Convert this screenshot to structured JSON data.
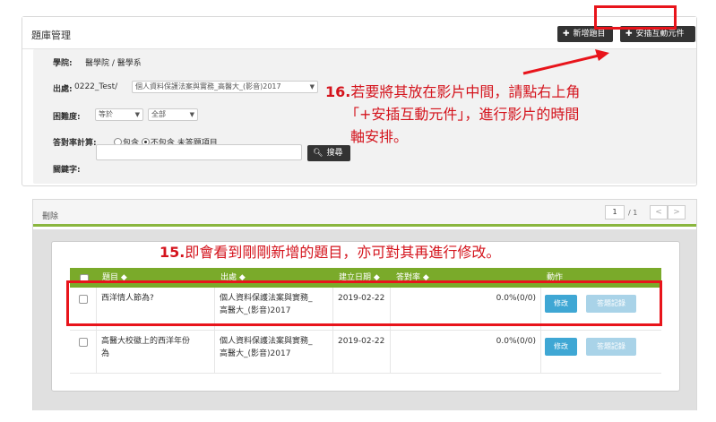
{
  "header": {
    "title": "題庫管理",
    "add_button": "新增題目",
    "insert_button": "安插互動元件"
  },
  "filters": {
    "school_label": "學院:",
    "school_value": "醫學院 / 醫學系",
    "source_label": "出處:",
    "source_prefix": "0222_Test/",
    "source_select": "個人資料保護法案與實務_高醫大_(影音)2017",
    "difficulty_label": "困難度:",
    "difficulty_op": "等於",
    "difficulty_value": "全部",
    "rate_label": "答對率計算:",
    "rate_option_include": "包含",
    "rate_option_exclude": "不包含 未答題項目",
    "keyword_label": "關鍵字:",
    "keyword_value": "",
    "search_button": "搜尋"
  },
  "annotation16": {
    "number": "16.",
    "line1": "若要將其放在影片中間，請點右上角",
    "line2": "「+安插互動元件」，進行影片的時間",
    "line3": "軸安排。"
  },
  "list": {
    "delete_label": "刪除",
    "page_current": "1",
    "page_total": "/ 1",
    "prev": "<",
    "next": ">"
  },
  "annotation15": {
    "number": "15.",
    "text": "即會看到剛剛新增的題目，亦可對其再進行修改。"
  },
  "table": {
    "columns": [
      "題目 ◆",
      "出處 ◆",
      "建立日期 ◆",
      "答對率 ◆",
      "動作"
    ],
    "rows": [
      {
        "question": "西洋情人節為?",
        "source_line1": "個人資料保護法案與實務_",
        "source_line2": "高醫大_(影音)2017",
        "date": "2019-02-22",
        "rate": "0.0%(0/0)",
        "edit": "修改",
        "record": "答題記錄"
      },
      {
        "question_line1": "高醫大校徽上的西洋年份",
        "question_line2": "為",
        "source_line1": "個人資料保護法案與實務_",
        "source_line2": "高醫大_(影音)2017",
        "date": "2019-02-22",
        "rate": "0.0%(0/0)",
        "edit": "修改",
        "record": "答題記錄"
      }
    ]
  },
  "colors": {
    "annotation_red": "#e8141b",
    "table_header_green": "#7aaa2a",
    "edit_blue": "#3fa7d4"
  }
}
